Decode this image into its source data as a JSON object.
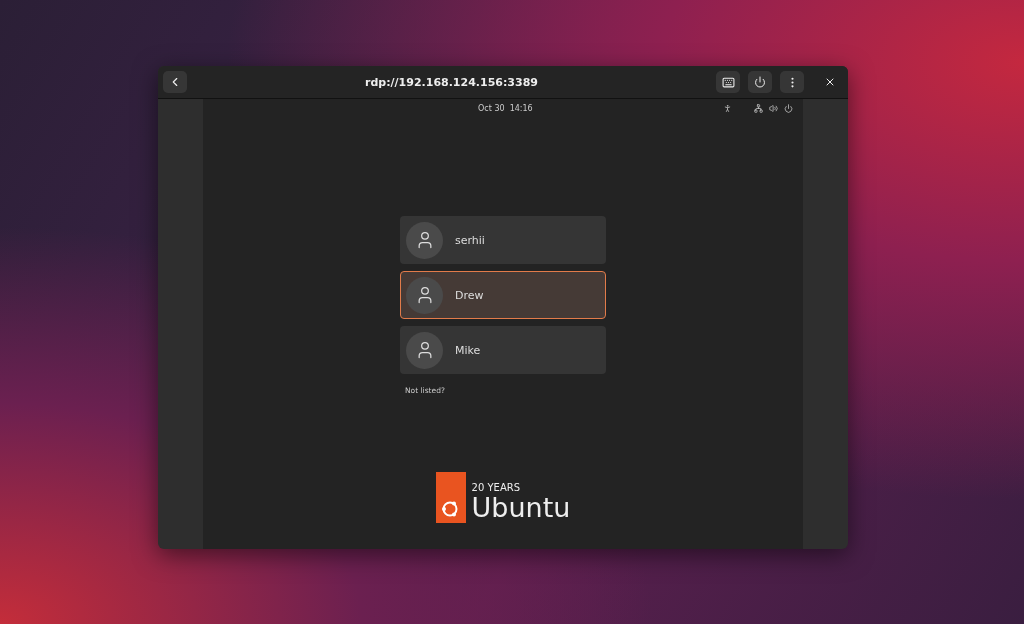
{
  "window": {
    "title": "rdp://192.168.124.156:3389"
  },
  "top_bar": {
    "date": "Oct 30",
    "time": "14:16"
  },
  "users": [
    {
      "name": "serhii",
      "selected": false
    },
    {
      "name": "Drew",
      "selected": true
    },
    {
      "name": "Mike",
      "selected": false
    }
  ],
  "not_listed": "Not listed?",
  "logo": {
    "tagline": "20 YEARS",
    "name": "Ubuntu"
  }
}
